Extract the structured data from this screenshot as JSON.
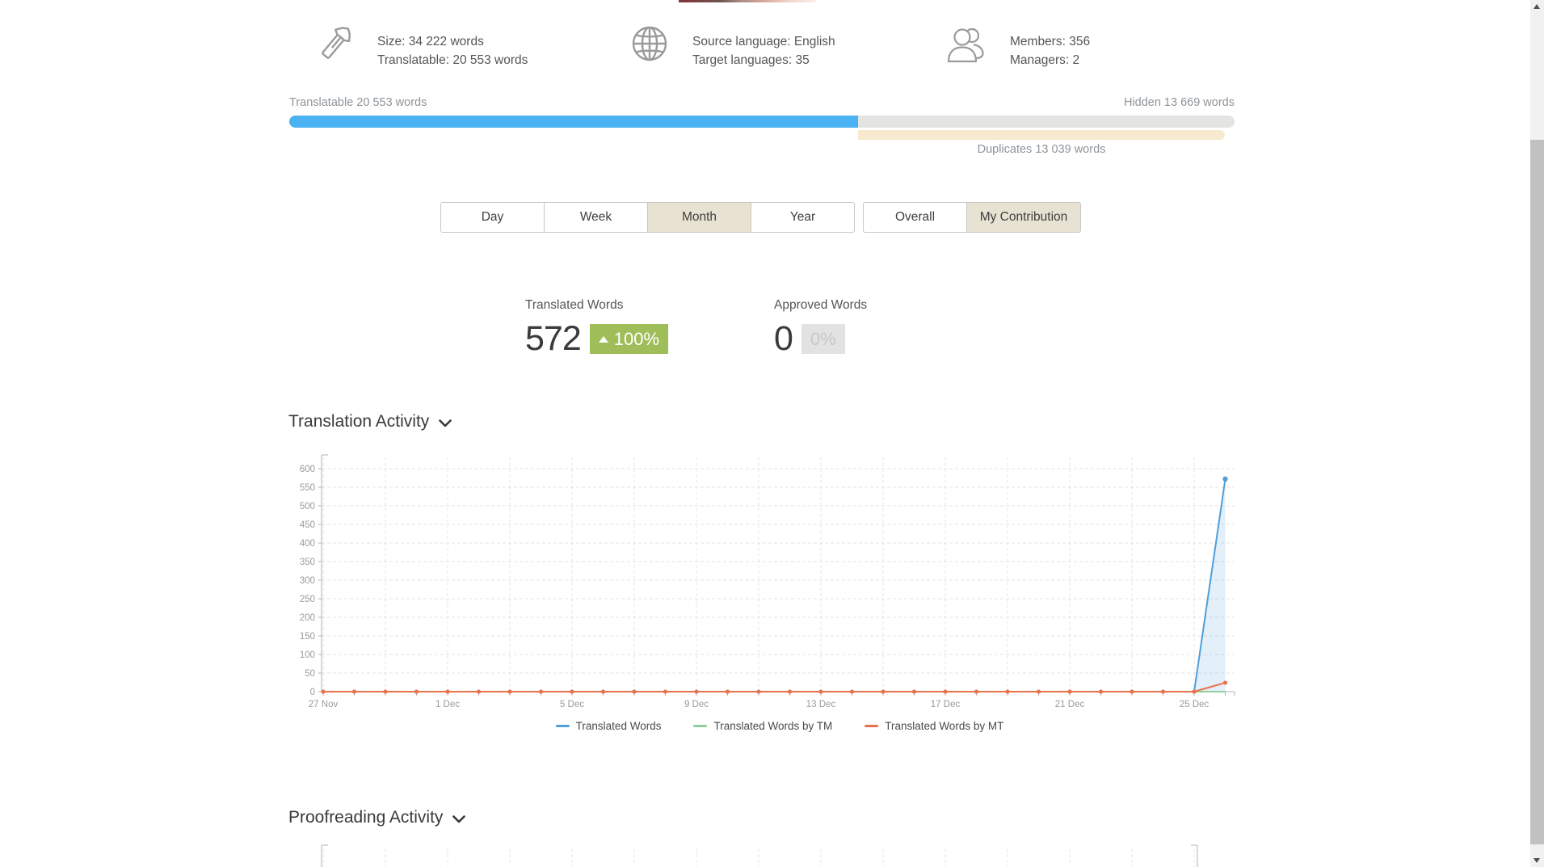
{
  "header_stats": {
    "size": {
      "icon": "caliper-icon",
      "line1": "Size: 34 222 words",
      "line2": "Translatable: 20 553 words"
    },
    "languages": {
      "icon": "globe-icon",
      "line1": "Source language: English",
      "line2": "Target languages: 35"
    },
    "people": {
      "icon": "members-icon",
      "line1": "Members: 356",
      "line2": "Managers: 2"
    }
  },
  "progress": {
    "translatable_label": "Translatable 20 553 words",
    "hidden_label": "Hidden 13 669 words",
    "duplicates_label": "Duplicates 13 039 words",
    "translatable_pct": 60.2,
    "colors": {
      "translatable": "#4ab1f2",
      "hidden": "#e4e4e2",
      "duplicates": "#f6e9cd"
    }
  },
  "tabs": {
    "period": [
      {
        "label": "Day",
        "active": false
      },
      {
        "label": "Week",
        "active": false
      },
      {
        "label": "Month",
        "active": true
      },
      {
        "label": "Year",
        "active": false
      }
    ],
    "scope": [
      {
        "label": "Overall",
        "active": false
      },
      {
        "label": "My Contribution",
        "active": true
      }
    ]
  },
  "kpis": {
    "translated": {
      "label": "Translated Words",
      "value": "572",
      "change": "100%",
      "trend": "up",
      "badge_color": "#9fbe5a"
    },
    "approved": {
      "label": "Approved Words",
      "value": "0",
      "change": "0%",
      "trend": "none",
      "badge_color": "#e2e2e2"
    }
  },
  "sections": {
    "translation": {
      "title": "Translation Activity"
    },
    "proofreading": {
      "title": "Proofreading Activity"
    }
  },
  "chart_data": {
    "type": "area",
    "title": "Translation Activity",
    "x": [
      "27 Nov",
      "28 Nov",
      "29 Nov",
      "30 Nov",
      "1 Dec",
      "2 Dec",
      "3 Dec",
      "4 Dec",
      "5 Dec",
      "6 Dec",
      "7 Dec",
      "8 Dec",
      "9 Dec",
      "10 Dec",
      "11 Dec",
      "12 Dec",
      "13 Dec",
      "14 Dec",
      "15 Dec",
      "16 Dec",
      "17 Dec",
      "18 Dec",
      "19 Dec",
      "20 Dec",
      "21 Dec",
      "22 Dec",
      "23 Dec",
      "24 Dec",
      "25 Dec",
      "26 Dec"
    ],
    "x_label_every": 4,
    "grid_x_every": 2,
    "ylim": [
      0,
      600
    ],
    "y_tick_step": 50,
    "grid": true,
    "legend_position": "bottom",
    "series": [
      {
        "name": "Translated Words",
        "color": "#4f9fd9",
        "values": [
          0,
          0,
          0,
          0,
          0,
          0,
          0,
          0,
          0,
          0,
          0,
          0,
          0,
          0,
          0,
          0,
          0,
          0,
          0,
          0,
          0,
          0,
          0,
          0,
          0,
          0,
          0,
          0,
          0,
          572
        ]
      },
      {
        "name": "Translated Words by TM",
        "color": "#92cf9f",
        "values": [
          0,
          0,
          0,
          0,
          0,
          0,
          0,
          0,
          0,
          0,
          0,
          0,
          0,
          0,
          0,
          0,
          0,
          0,
          0,
          0,
          0,
          0,
          0,
          0,
          0,
          0,
          0,
          0,
          0,
          0
        ]
      },
      {
        "name": "Translated Words by MT",
        "color": "#e9714b",
        "values": [
          0,
          0,
          0,
          0,
          0,
          0,
          0,
          0,
          0,
          0,
          0,
          0,
          0,
          0,
          0,
          0,
          0,
          0,
          0,
          0,
          0,
          0,
          0,
          0,
          0,
          0,
          0,
          0,
          0,
          24
        ]
      }
    ]
  }
}
